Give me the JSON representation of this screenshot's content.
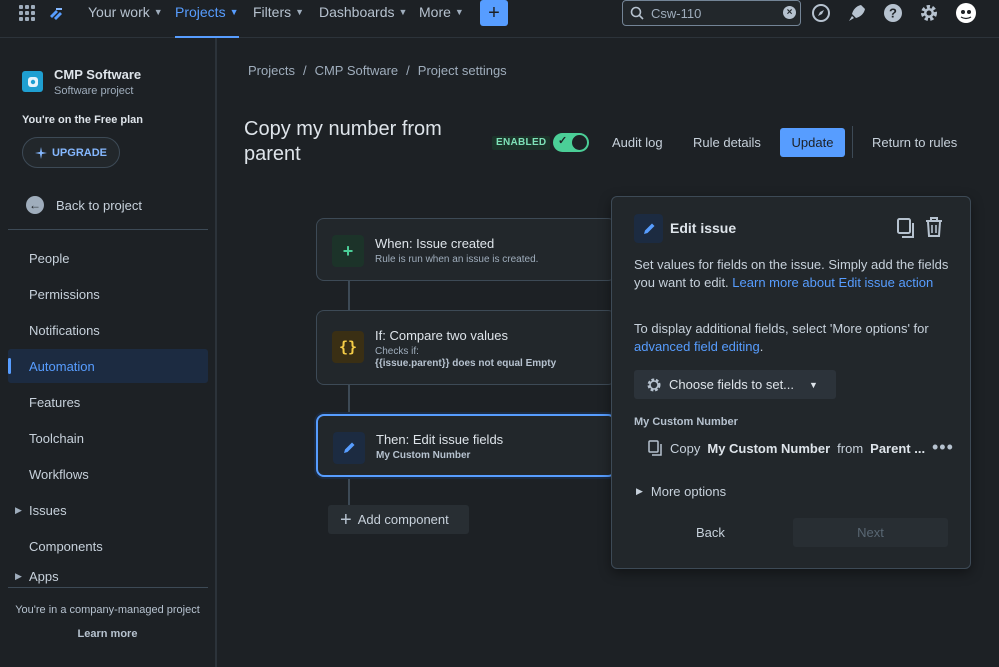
{
  "topnav": {
    "items": [
      {
        "label": "Your work"
      },
      {
        "label": "Projects"
      },
      {
        "label": "Filters"
      },
      {
        "label": "Dashboards"
      },
      {
        "label": "More"
      }
    ],
    "active_item": "Projects",
    "search_value": "Csw-110"
  },
  "sidebar": {
    "project_name": "CMP Software",
    "project_type": "Software project",
    "plan_text": "You're on the Free plan",
    "upgrade_label": "UPGRADE",
    "back_label": "Back to project",
    "items": [
      {
        "label": "People"
      },
      {
        "label": "Permissions"
      },
      {
        "label": "Notifications"
      },
      {
        "label": "Automation"
      },
      {
        "label": "Features"
      },
      {
        "label": "Toolchain"
      },
      {
        "label": "Workflows"
      },
      {
        "label": "Issues"
      },
      {
        "label": "Components"
      },
      {
        "label": "Apps"
      }
    ],
    "active_item": "Automation",
    "managed_text": "You're in a company-managed project",
    "learn_more": "Learn more"
  },
  "breadcrumb": {
    "items": [
      "Projects",
      "CMP Software",
      "Project settings"
    ],
    "separator": "/"
  },
  "rule": {
    "title": "Copy my number from parent",
    "status_badge": "ENABLED",
    "enabled": true,
    "audit_log": "Audit log",
    "rule_details": "Rule details",
    "update": "Update",
    "return": "Return to rules"
  },
  "flow": {
    "trigger": {
      "title": "When: Issue created",
      "subtitle": "Rule is run when an issue is created."
    },
    "condition": {
      "title": "If: Compare two values",
      "subtitle": "Checks if:",
      "detail": "{{issue.parent}} does not equal Empty"
    },
    "action": {
      "title": "Then: Edit issue fields",
      "subtitle": "My Custom Number"
    },
    "add_component": "Add component"
  },
  "panel": {
    "title": "Edit issue",
    "desc1_text": "Set values for fields on the issue. Simply add the fields you want to edit.",
    "desc1_link": "Learn more about Edit issue action",
    "desc2_text": "To display additional fields, select 'More options' for",
    "desc2_link": "advanced field editing",
    "desc2_end": ".",
    "choose_fields": "Choose fields to set...",
    "field_label": "My Custom Number",
    "field_value_pre": "Copy",
    "field_value_field": "My Custom Number",
    "field_value_mid": "from",
    "field_value_src": "Parent ...",
    "more_options": "More options",
    "back": "Back",
    "next": "Next"
  },
  "colors": {
    "accent": "#579dff",
    "background": "#1d2125",
    "success": "#4bce97"
  },
  "icons": [
    "app-switcher-icon",
    "jira-logo-icon",
    "search-icon",
    "clear-icon",
    "compass-icon",
    "rocket-icon",
    "help-icon",
    "settings-icon",
    "avatar",
    "edit-icon",
    "copy-icon",
    "trash-icon",
    "gear-icon",
    "plus-icon",
    "curly-braces-icon"
  ]
}
